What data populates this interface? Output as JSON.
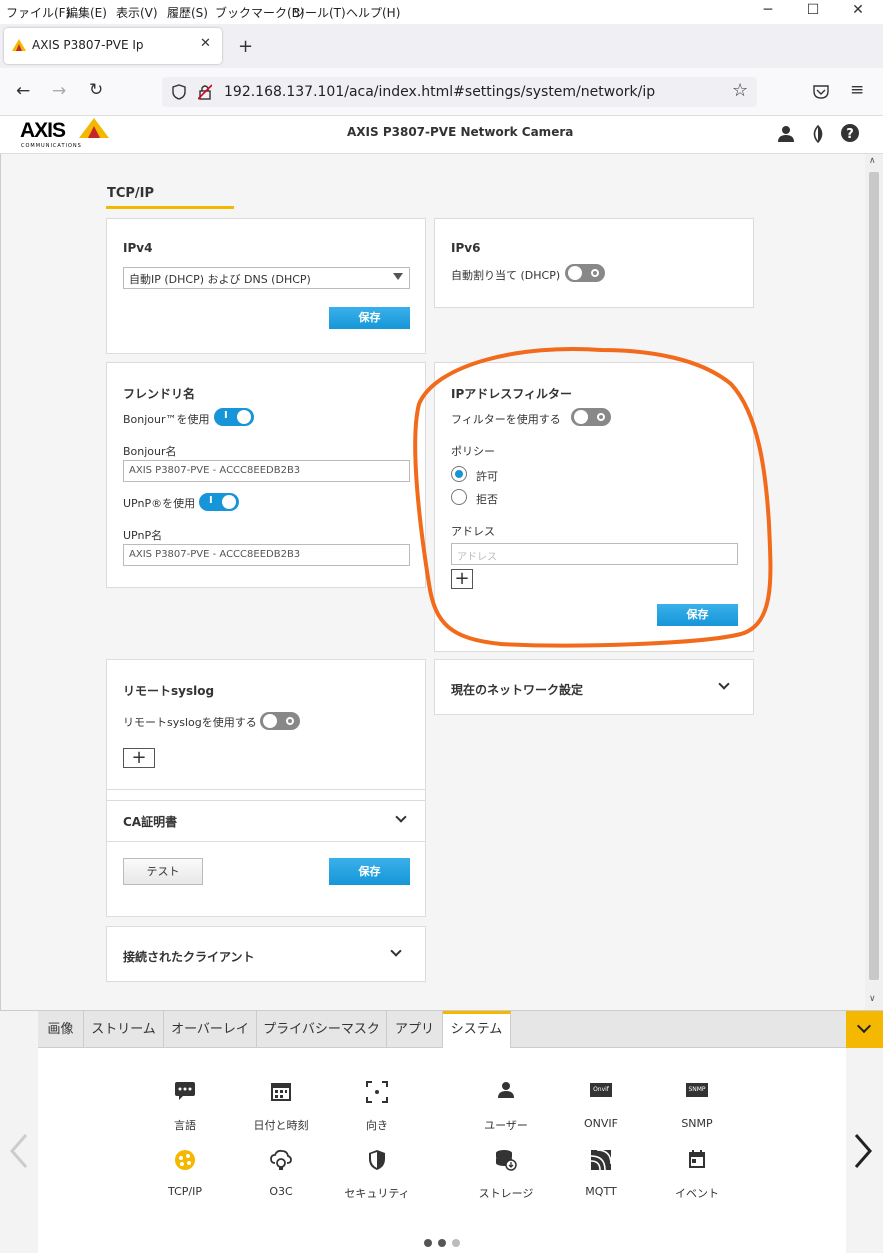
{
  "menubar": {
    "items": [
      "ファイル(F)",
      "編集(E)",
      "表示(V)",
      "履歴(S)",
      "ブックマーク(B)",
      "ツール(T)",
      "ヘルプ(H)"
    ]
  },
  "browser": {
    "tab_title": "AXIS P3807-PVE Ip",
    "url": "192.168.137.101/aca/index.html#settings/system/network/ip"
  },
  "header": {
    "logo": "AXIS",
    "logo_sub": "COMMUNICATIONS",
    "title": "AXIS P3807-PVE Network Camera"
  },
  "page": {
    "heading": "TCP/IP"
  },
  "ipv4": {
    "title": "IPv4",
    "select_value": "自動IP (DHCP) および DNS (DHCP)",
    "save": "保存"
  },
  "ipv6": {
    "title": "IPv6",
    "auto_label": "自動割り当て (DHCP)"
  },
  "friendly": {
    "title": "フレンドリ名",
    "bonjour_use": "Bonjour™を使用",
    "bonjour_name_label": "Bonjour名",
    "bonjour_name": "AXIS P3807-PVE - ACCC8EEDB2B3",
    "upnp_use": "UPnP®を使用",
    "upnp_name_label": "UPnP名",
    "upnp_name": "AXIS P3807-PVE - ACCC8EEDB2B3",
    "toggle_on_text": "I"
  },
  "ipfilter": {
    "title": "IPアドレスフィルター",
    "use_filter": "フィルターを使用する",
    "policy_label": "ポリシー",
    "allow": "許可",
    "deny": "拒否",
    "address_label": "アドレス",
    "address_placeholder": "アドレス",
    "save": "保存",
    "annotation_color": "#f26a1b"
  },
  "syslog": {
    "title": "リモートsyslog",
    "use": "リモートsyslogを使用する"
  },
  "ca": {
    "title": "CA証明書",
    "test": "テスト",
    "save": "保存"
  },
  "netstatus": {
    "title": "現在のネットワーク設定"
  },
  "clients": {
    "title": "接続されたクライアント"
  },
  "bottom": {
    "tabs": [
      "画像",
      "ストリーム",
      "オーバーレイ",
      "プライバシーマスク",
      "アプリ",
      "システム"
    ],
    "active_tab": "システム",
    "row1": [
      "言語",
      "日付と時刻",
      "向き",
      "ユーザー",
      "ONVIF",
      "SNMP"
    ],
    "row2": [
      "TCP/IP",
      "O3C",
      "セキュリティ",
      "ストレージ",
      "MQTT",
      "イベント"
    ],
    "onvif_badge": "Onvif",
    "snmp_badge": "SNMP",
    "accent": "#f5b800"
  }
}
